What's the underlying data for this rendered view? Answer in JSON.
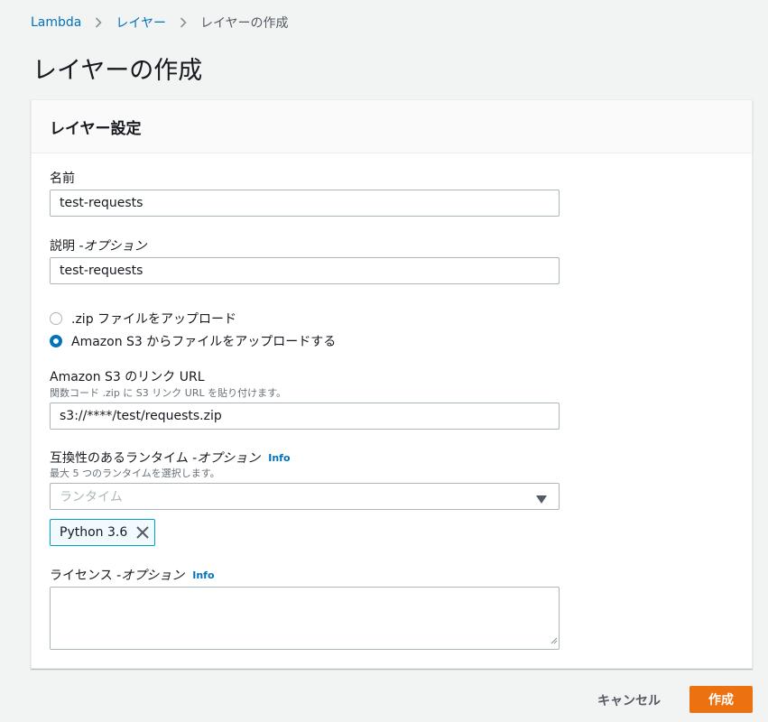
{
  "breadcrumb": {
    "items": [
      "Lambda",
      "レイヤー"
    ],
    "current": "レイヤーの作成"
  },
  "page": {
    "title": "レイヤーの作成"
  },
  "panel": {
    "title": "レイヤー設定"
  },
  "form": {
    "name": {
      "label": "名前",
      "value": "test-requests"
    },
    "description": {
      "label": "説明 - ",
      "label_optional": "オプション",
      "value": "test-requests"
    },
    "upload": {
      "options": [
        {
          "label": ".zip ファイルをアップロード",
          "checked": false
        },
        {
          "label": "Amazon S3 からファイルをアップロードする",
          "checked": true
        }
      ]
    },
    "s3_url": {
      "label": "Amazon S3 のリンク URL",
      "description": "関数コード .zip に S3 リンク URL を貼り付けます。",
      "value": "s3://****/test/requests.zip"
    },
    "runtimes": {
      "label": "互換性のあるランタイム - ",
      "label_optional": "オプション",
      "info": "Info",
      "description": "最大 5 つのランタイムを選択します。",
      "placeholder": "ランタイム",
      "selected": [
        "Python 3.6"
      ]
    },
    "license": {
      "label": "ライセンス - ",
      "label_optional": "オプション",
      "info": "Info",
      "value": ""
    }
  },
  "actions": {
    "cancel": "キャンセル",
    "create": "作成"
  },
  "colors": {
    "link": "#0073bb",
    "primary": "#ec7211",
    "token_border": "#00a1c9",
    "token_bg": "#f1faff",
    "page_bg": "#f2f3f3"
  },
  "icons": {
    "breadcrumb_separator": "chevron-right-icon",
    "select_caret": "caret-down-icon",
    "token_remove": "close-icon"
  }
}
